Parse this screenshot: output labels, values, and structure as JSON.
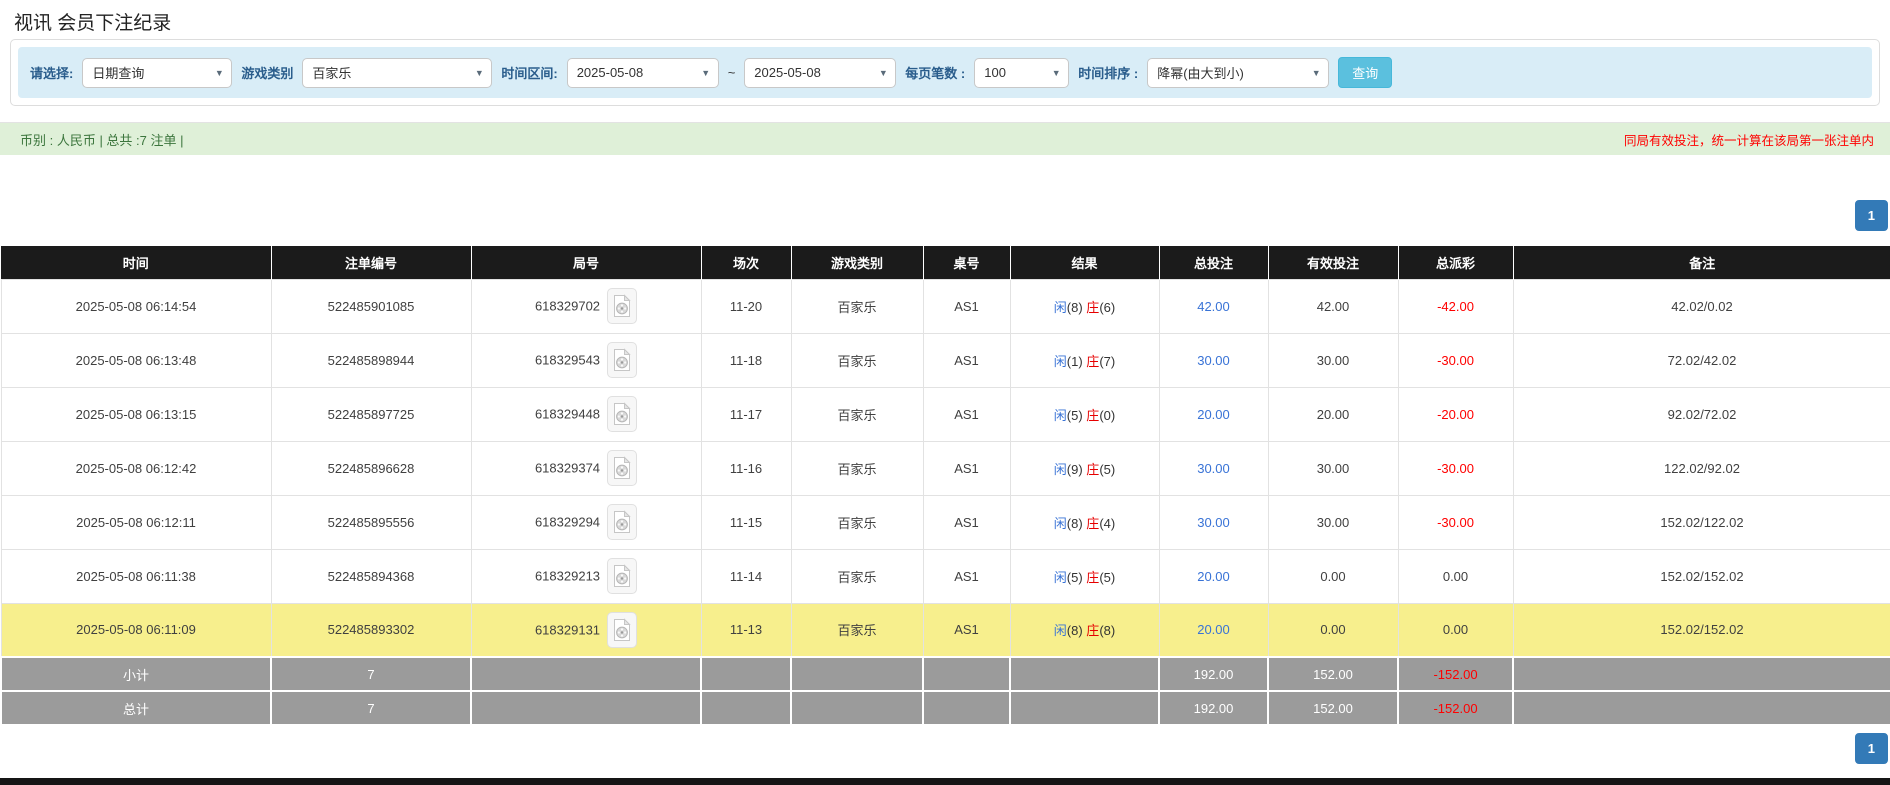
{
  "title": "视讯 会员下注纪录",
  "filters": {
    "select_label": "请选择:",
    "select_value": "日期查询",
    "game_type_label": "游戏类别",
    "game_type_value": "百家乐",
    "time_range_label": "时间区间:",
    "time_from": "2025-05-08",
    "time_to": "2025-05-08",
    "tilde": "~",
    "page_size_label": "每页笔数 :",
    "page_size_value": "100",
    "sort_label": "时间排序 :",
    "sort_value": "降幂(由大到小)",
    "search_button": "查询"
  },
  "info_bar": {
    "left": "币别 : 人民币 | 总共 :7 注单 |",
    "right": "同局有效投注，统一计算在该局第一张注单内"
  },
  "pagination": {
    "page": "1"
  },
  "colors": {
    "accent_blue": "#337ab7",
    "link_blue": "#3973d6",
    "notice_red": "#ff0000",
    "highlight_yellow": "#f7ef8d",
    "header_black": "#1b1b1b",
    "info_green_bg": "#dff0d8",
    "summary_gray": "#9b9b9b",
    "search_btn_cyan": "#5bc0de"
  },
  "table": {
    "headers": [
      "时间",
      "注单编号",
      "局号",
      "场次",
      "游戏类别",
      "桌号",
      "结果",
      "总投注",
      "有效投注",
      "总派彩",
      "备注"
    ],
    "rows": [
      {
        "time": "2025-05-08 06:14:54",
        "bet_id": "522485901085",
        "round_id": "618329702",
        "session": "11-20",
        "game": "百家乐",
        "table_no": "AS1",
        "result_p": "闲",
        "result_pn": "(8) ",
        "result_b": "庄",
        "result_bn": "(6)",
        "total_bet": "42.00",
        "valid_bet": "42.00",
        "payout": "-42.00",
        "remark": "42.02/0.02",
        "highlight": false
      },
      {
        "time": "2025-05-08 06:13:48",
        "bet_id": "522485898944",
        "round_id": "618329543",
        "session": "11-18",
        "game": "百家乐",
        "table_no": "AS1",
        "result_p": "闲",
        "result_pn": "(1) ",
        "result_b": "庄",
        "result_bn": "(7)",
        "total_bet": "30.00",
        "valid_bet": "30.00",
        "payout": "-30.00",
        "remark": "72.02/42.02",
        "highlight": false
      },
      {
        "time": "2025-05-08 06:13:15",
        "bet_id": "522485897725",
        "round_id": "618329448",
        "session": "11-17",
        "game": "百家乐",
        "table_no": "AS1",
        "result_p": "闲",
        "result_pn": "(5) ",
        "result_b": "庄",
        "result_bn": "(0)",
        "total_bet": "20.00",
        "valid_bet": "20.00",
        "payout": "-20.00",
        "remark": "92.02/72.02",
        "highlight": false
      },
      {
        "time": "2025-05-08 06:12:42",
        "bet_id": "522485896628",
        "round_id": "618329374",
        "session": "11-16",
        "game": "百家乐",
        "table_no": "AS1",
        "result_p": "闲",
        "result_pn": "(9) ",
        "result_b": "庄",
        "result_bn": "(5)",
        "total_bet": "30.00",
        "valid_bet": "30.00",
        "payout": "-30.00",
        "remark": "122.02/92.02",
        "highlight": false
      },
      {
        "time": "2025-05-08 06:12:11",
        "bet_id": "522485895556",
        "round_id": "618329294",
        "session": "11-15",
        "game": "百家乐",
        "table_no": "AS1",
        "result_p": "闲",
        "result_pn": "(8) ",
        "result_b": "庄",
        "result_bn": "(4)",
        "total_bet": "30.00",
        "valid_bet": "30.00",
        "payout": "-30.00",
        "remark": "152.02/122.02",
        "highlight": false
      },
      {
        "time": "2025-05-08 06:11:38",
        "bet_id": "522485894368",
        "round_id": "618329213",
        "session": "11-14",
        "game": "百家乐",
        "table_no": "AS1",
        "result_p": "闲",
        "result_pn": "(5) ",
        "result_b": "庄",
        "result_bn": "(5)",
        "total_bet": "20.00",
        "valid_bet": "0.00",
        "payout": "0.00",
        "remark": "152.02/152.02",
        "highlight": false
      },
      {
        "time": "2025-05-08 06:11:09",
        "bet_id": "522485893302",
        "round_id": "618329131",
        "session": "11-13",
        "game": "百家乐",
        "table_no": "AS1",
        "result_p": "闲",
        "result_pn": "(8) ",
        "result_b": "庄",
        "result_bn": "(8)",
        "total_bet": "20.00",
        "valid_bet": "0.00",
        "payout": "0.00",
        "remark": "152.02/152.02",
        "highlight": true
      }
    ],
    "subtotal": {
      "label": "小计",
      "count": "7",
      "total_bet": "192.00",
      "valid_bet": "152.00",
      "payout": "-152.00"
    },
    "total": {
      "label": "总计",
      "count": "7",
      "total_bet": "192.00",
      "valid_bet": "152.00",
      "payout": "-152.00"
    }
  }
}
